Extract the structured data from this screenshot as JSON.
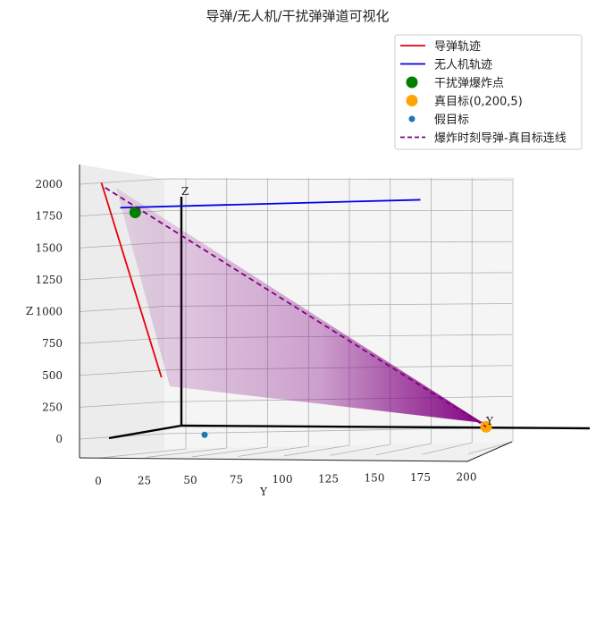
{
  "chart_data": {
    "type": "line",
    "title": "导弹/无人机/干扰弹弹道可视化",
    "xlabel": "",
    "ylabel": "Y",
    "zlabel": "Z",
    "ylim": [
      0,
      210
    ],
    "zlim": [
      0,
      2100
    ],
    "y_ticks": [
      0,
      25,
      50,
      75,
      100,
      125,
      150,
      175,
      200
    ],
    "z_ticks": [
      0,
      250,
      500,
      750,
      1000,
      1250,
      1500,
      1750,
      2000
    ],
    "grid": true,
    "legend_position": "top-right",
    "series": [
      {
        "name": "导弹轨迹",
        "kind": "line",
        "color": "#e8000b",
        "style": "solid",
        "points": [
          [
            -5,
            2000
          ],
          [
            27,
            460
          ]
        ]
      },
      {
        "name": "无人机轨迹",
        "kind": "line",
        "color": "#0000e6",
        "style": "solid",
        "points": [
          [
            5,
            1800
          ],
          [
            165,
            1800
          ]
        ]
      },
      {
        "name": "干扰弹爆炸点",
        "kind": "point",
        "color": "#008000",
        "points": [
          [
            13,
            1760
          ]
        ]
      },
      {
        "name": "真目标(0,200,5)",
        "kind": "point",
        "color": "#ffa500",
        "points": [
          [
            200,
            5
          ]
        ]
      },
      {
        "name": "假目标",
        "kind": "point",
        "color": "#1f77b4",
        "points": [
          [
            50,
            0
          ]
        ]
      },
      {
        "name": "爆炸时刻导弹-真目标连线",
        "kind": "line",
        "color": "#800080",
        "style": "dashed",
        "points": [
          [
            -3,
            1960
          ],
          [
            200,
            5
          ]
        ]
      }
    ],
    "axis_letters": {
      "z": "Z",
      "y": "Y"
    },
    "colors": {
      "cone": "#800080",
      "pane": "#f3f3f3",
      "grid": "#b0b0b0"
    }
  }
}
